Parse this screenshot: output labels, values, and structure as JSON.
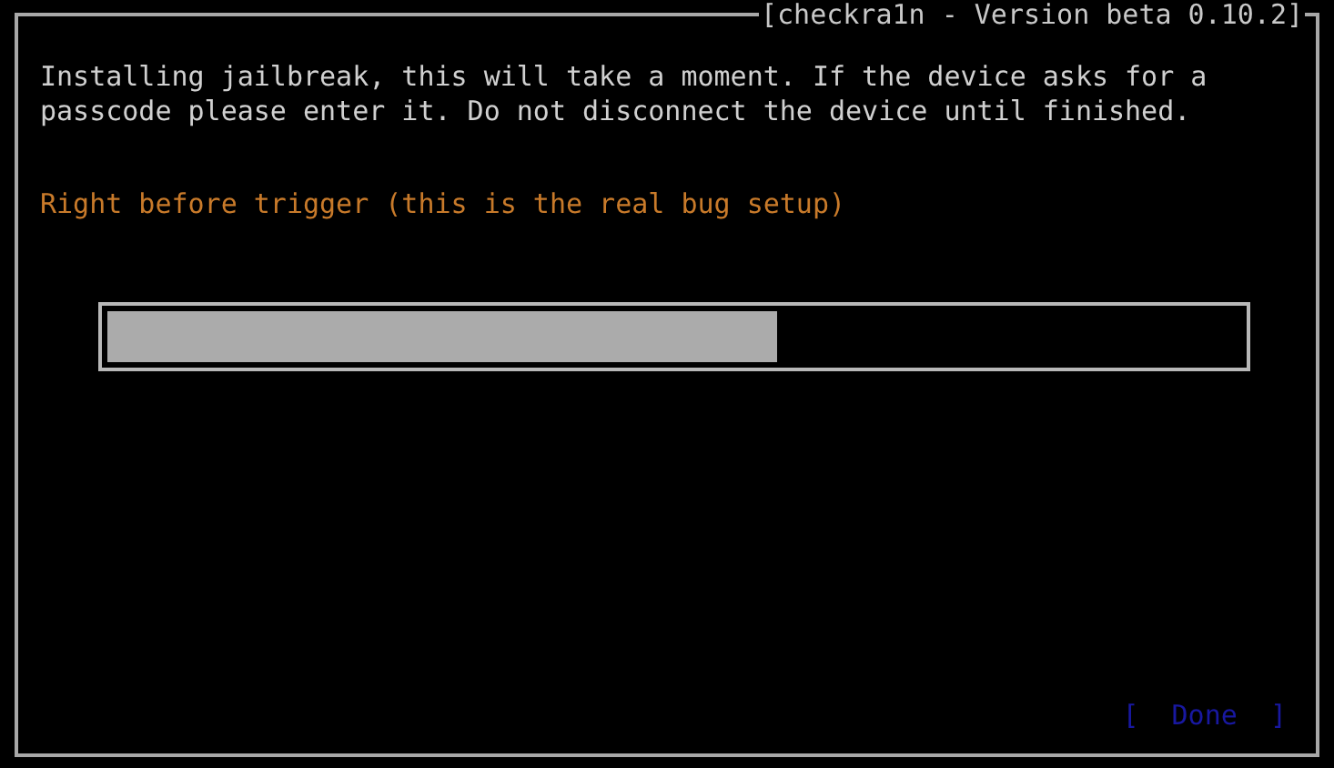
{
  "window": {
    "title": "[checkra1n - Version beta 0.10.2]"
  },
  "message": "Installing jailbreak, this will take a moment. If the device asks for a passcode please enter it. Do not disconnect the device until finished.",
  "status": "Right before trigger (this is the real bug setup)",
  "progress": {
    "level": 0.59
  },
  "buttons": [
    {
      "label": "[  Done  ]",
      "disabled": true
    }
  ]
}
